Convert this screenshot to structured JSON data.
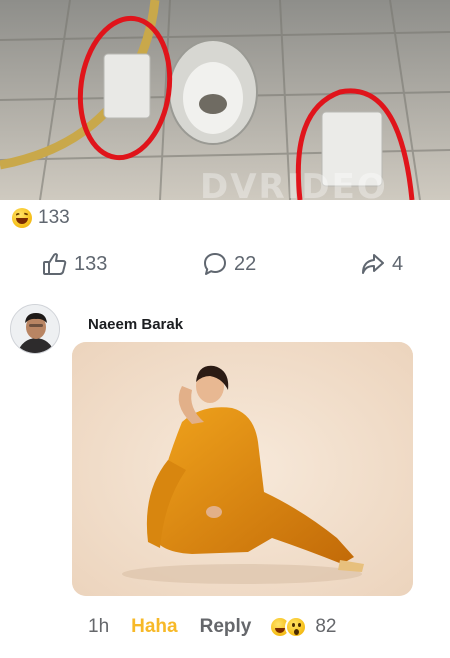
{
  "post": {
    "photo_watermark": "DVRIDEO",
    "reaction_count": "133",
    "actions": {
      "like_count": "133",
      "comment_count": "22",
      "share_count": "4"
    }
  },
  "comment": {
    "author": "Naeem Barak",
    "time": "1h",
    "haha_label": "Haha",
    "reply_label": "Reply",
    "reaction_count": "82"
  },
  "icons": {
    "reaction_summary": "haha-emoji-icon",
    "like": "thumbs-up-icon",
    "comment": "comment-bubble-icon",
    "share": "share-arrow-icon",
    "comment_reactions": [
      "haha-emoji-icon",
      "wow-emoji-icon"
    ]
  },
  "colors": {
    "haha_link": "#f7b928",
    "annotation_circle": "#e0141b",
    "text_secondary": "#65676b"
  }
}
